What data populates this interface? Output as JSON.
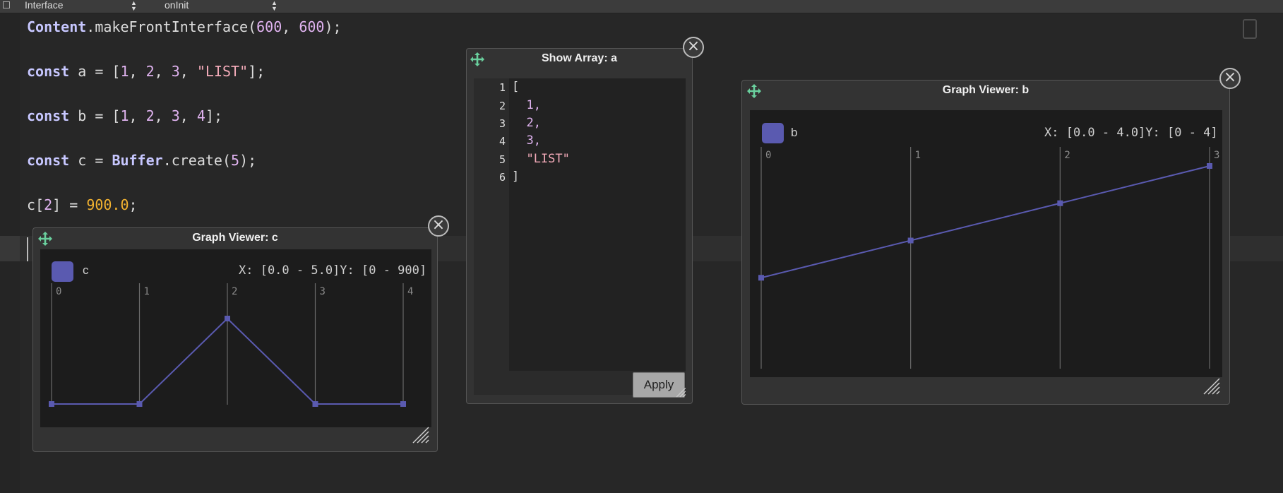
{
  "toolbar": {
    "interface_combo": "Interface",
    "callback_combo": "onInit"
  },
  "code": {
    "line1": {
      "obj": "Content",
      "rest1": ".makeFrontInterface(",
      "n1": "600",
      "sep": ", ",
      "n2": "600",
      "end": ");"
    },
    "line2": {
      "kw": "const",
      "mid": " a = [",
      "n1": "1",
      "s1": ", ",
      "n2": "2",
      "s2": ", ",
      "n3": "3",
      "s3": ", ",
      "str": "\"LIST\"",
      "end": "];"
    },
    "line3": {
      "kw": "const",
      "mid": " b = [",
      "n1": "1",
      "s1": ", ",
      "n2": "2",
      "s2": ", ",
      "n3": "3",
      "s3": ", ",
      "n4": "4",
      "end": "];"
    },
    "line4": {
      "kw": "const",
      "mid": " c = ",
      "obj": "Buffer",
      "call": ".create(",
      "n1": "5",
      "end": ");"
    },
    "line5": {
      "pre": "c[",
      "n1": "2",
      "mid": "] = ",
      "flt": "900.0",
      "end": ";"
    }
  },
  "show_array": {
    "title": "Show Array: a",
    "line_numbers": [
      "1",
      "2",
      "3",
      "4",
      "5",
      "6"
    ],
    "lines": [
      "[",
      "  1,",
      "  2,",
      "  3,",
      "  \"LIST\"",
      "]"
    ],
    "apply_label": "Apply"
  },
  "graph_c": {
    "title": "Graph Viewer: c",
    "legend": "c",
    "range": "X: [0.0 - 5.0]Y: [0 - 900]",
    "ticks": [
      "0",
      "1",
      "2",
      "3",
      "4"
    ]
  },
  "graph_b": {
    "title": "Graph Viewer: b",
    "legend": "b",
    "range": "X: [0.0 - 4.0]Y: [0 - 4]",
    "ticks": [
      "0",
      "1",
      "2",
      "3"
    ]
  },
  "chart_data": [
    {
      "type": "line",
      "series": [
        {
          "name": "c",
          "values": [
            0,
            0,
            900,
            0,
            0
          ]
        }
      ],
      "x": [
        0,
        1,
        2,
        3,
        4
      ],
      "xlim": [
        0,
        5
      ],
      "ylim": [
        0,
        900
      ]
    },
    {
      "type": "line",
      "series": [
        {
          "name": "b",
          "values": [
            1,
            2,
            3,
            4
          ]
        }
      ],
      "x": [
        0,
        1,
        2,
        3
      ],
      "xlim": [
        0,
        4
      ],
      "ylim": [
        0,
        4
      ]
    }
  ],
  "colors": {
    "series": "#5a5ab0",
    "background": "#272727",
    "panel": "#333333"
  },
  "icons": {
    "move": "move-icon",
    "close": "close-icon",
    "resize": "resize-grip-icon"
  }
}
